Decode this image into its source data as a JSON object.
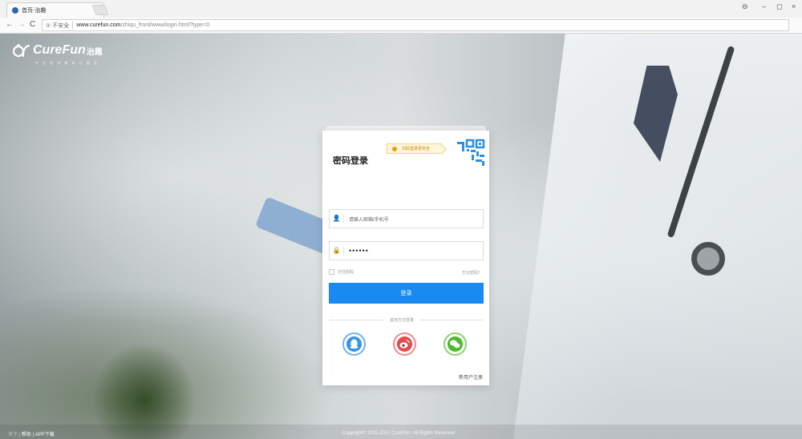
{
  "browser": {
    "tab_title": "首页-治趣",
    "tab_close": "×",
    "security_label": "① 不安全",
    "url_domain": "www.curefun.com",
    "url_path": "/zhiqu_front/www/login.html?type=0",
    "window_controls": [
      "⊖",
      "–",
      "◻",
      "×"
    ]
  },
  "brand": {
    "name": "CureFun",
    "name_cn": "治趣",
    "slogan": "专 注 医 学 教 育 与 服 务"
  },
  "login": {
    "title": "密码登录",
    "qr_tip": "扫码登录更安全",
    "account_placeholder": "请输入邮箱/手机号",
    "password_value": "••••••",
    "remember_label": "记住密码",
    "forgot_label": "忘记密码？",
    "submit_label": "登录",
    "other_methods_label": "其他方式登录",
    "social": [
      "QQ",
      "微博",
      "微信"
    ],
    "register_label": "新用户注册"
  },
  "footer": {
    "links": [
      "关于",
      "帮助",
      "APP下载"
    ],
    "copyright": "Copyright© 2015-2017 CureFun. All Rights Reserved"
  }
}
